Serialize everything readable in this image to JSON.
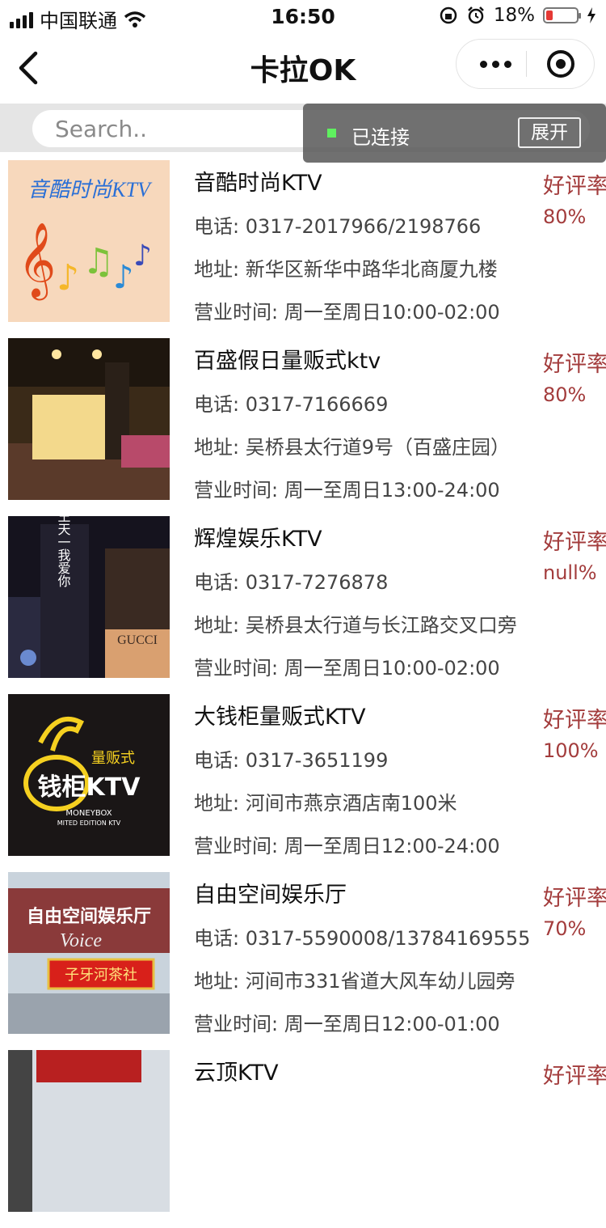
{
  "status_bar": {
    "carrier": "中国联通",
    "time": "16:50",
    "battery": "18%"
  },
  "nav": {
    "title": "卡拉OK"
  },
  "search": {
    "placeholder": "Search.."
  },
  "connection": {
    "status": "已连接",
    "expand_label": "展开"
  },
  "labels": {
    "phone_prefix": "电话: ",
    "address_prefix": "地址: ",
    "hours_prefix": "营业时间: ",
    "rating_label": "好评率"
  },
  "items": [
    {
      "name": "音酷时尚KTV",
      "phone": "0317-2017966/2198766",
      "address": "新华区新华中路华北商厦九楼",
      "hours": "周一至周日10:00-02:00",
      "rating": "80%"
    },
    {
      "name": "百盛假日量贩式ktv",
      "phone": "0317-7166669",
      "address": "吴桥县太行道9号（百盛庄园）",
      "hours": "周一至周日13:00-24:00",
      "rating": "80%"
    },
    {
      "name": "辉煌娱乐KTV",
      "phone": "0317-7276878",
      "address": "吴桥县太行道与长江路交叉口旁",
      "hours": "周一至周日10:00-02:00",
      "rating": "null%"
    },
    {
      "name": "大钱柜量贩式KTV",
      "phone": "0317-3651199",
      "address": "河间市燕京酒店南100米",
      "hours": "周一至周日12:00-24:00",
      "rating": "100%"
    },
    {
      "name": "自由空间娱乐厅",
      "phone": "0317-5590008/13784169555",
      "address": "河间市331省道大风车幼儿园旁",
      "hours": "周一至周日12:00-01:00",
      "rating": "70%"
    },
    {
      "name": "云顶KTV",
      "rating_only": true
    }
  ],
  "thumb_text": {
    "t1_title": "音酷时尚KTV",
    "t3_sign": "王天一我爱你",
    "t3_brand": "GUCCI",
    "t4_small": "量贩式",
    "t4_main": "钱柜KTV",
    "t4_en1": "MONEYBOX",
    "t4_en2": "MITED EDITION KTV",
    "t5_sign": "自由空间娱乐厅",
    "t5_voice": "Voice",
    "t5_shop": "子牙河茶社"
  },
  "colors": {
    "accent_red": "#a33c3c",
    "connected_green": "#5ff05f"
  },
  "icons": [
    "back-chevron-icon",
    "more-dots-icon",
    "close-target-icon",
    "wifi-icon",
    "alarm-icon",
    "lock-rotation-icon",
    "battery-icon",
    "charging-icon"
  ]
}
